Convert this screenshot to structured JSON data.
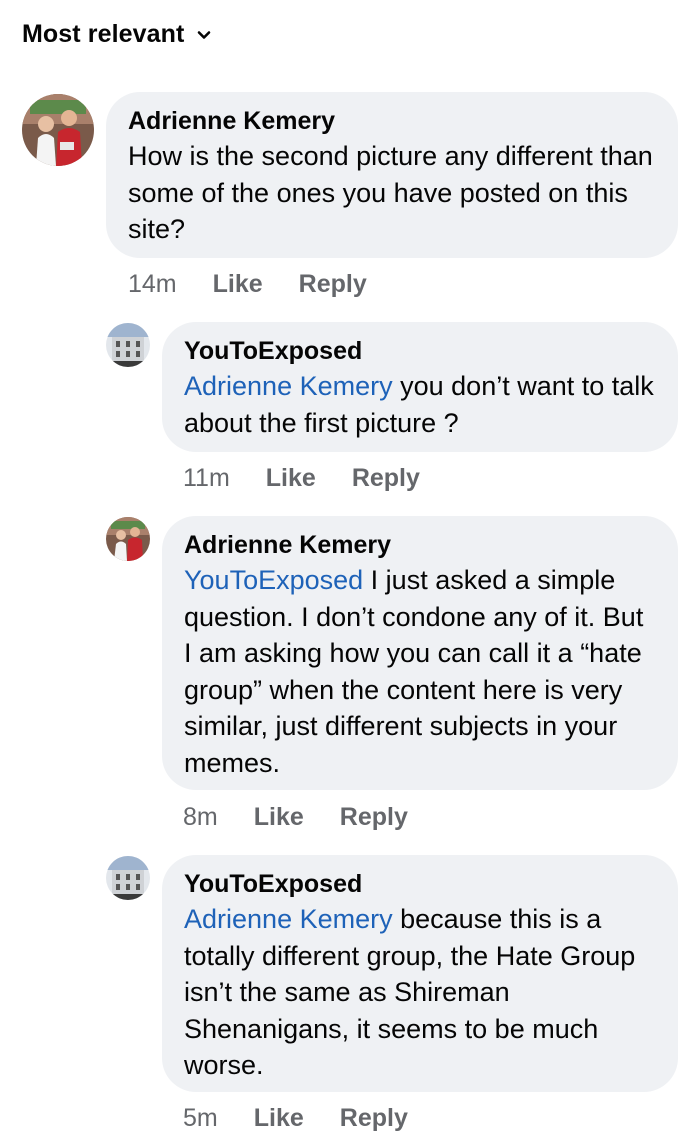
{
  "sort": {
    "label": "Most relevant",
    "icon": "chevron-down-icon"
  },
  "comments": [
    {
      "author": "Adrienne Kemery",
      "mention": "",
      "text": "How is the second picture any different than some of the ones you have posted on this site?",
      "time": "14m",
      "like_label": "Like",
      "reply_label": "Reply",
      "is_reply": false
    },
    {
      "author": "YouToExposed",
      "mention": "Adrienne Kemery",
      "text": "you don’t want to talk about the first picture ?",
      "time": "11m",
      "like_label": "Like",
      "reply_label": "Reply",
      "is_reply": true
    },
    {
      "author": "Adrienne Kemery",
      "mention": "YouToExposed",
      "text": "I just asked a simple question.  I don’t condone any of it.  But I am asking how you can call it a “hate group” when the content here is very similar, just different subjects in your memes.",
      "time": "8m",
      "like_label": "Like",
      "reply_label": "Reply",
      "is_reply": true
    },
    {
      "author": "YouToExposed",
      "mention": "Adrienne Kemery",
      "text": "because this is a totally different group, the Hate Group isn’t the same as Shireman Shenanigans, it seems to be much worse.",
      "time": "5m",
      "like_label": "Like",
      "reply_label": "Reply",
      "is_reply": true
    }
  ],
  "colors": {
    "bubble": "#eff1f4",
    "mention": "#1e62b8",
    "meta": "#65676b",
    "text": "#050505"
  }
}
